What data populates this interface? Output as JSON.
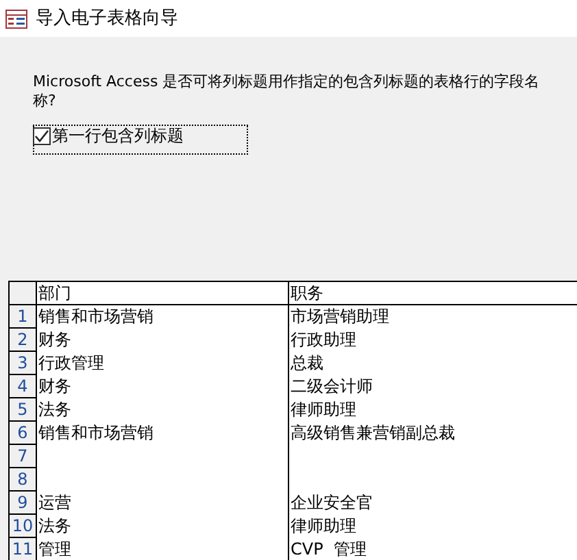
{
  "window": {
    "title": "导入电子表格向导"
  },
  "question": "Microsoft Access 是否可将列标题用作指定的包含列标题的表格行的字段名称?",
  "header_checkbox": {
    "label": "第一行包含列标题",
    "checked": true
  },
  "table": {
    "columns": [
      "部门",
      "职务"
    ],
    "rows": [
      {
        "number": "1",
        "cells": [
          "销售和市场营销",
          "市场营销助理"
        ]
      },
      {
        "number": "2",
        "cells": [
          "财务",
          "行政助理"
        ]
      },
      {
        "number": "3",
        "cells": [
          "行政管理",
          "总裁"
        ]
      },
      {
        "number": "4",
        "cells": [
          "财务",
          "二级会计师"
        ]
      },
      {
        "number": "5",
        "cells": [
          "法务",
          "律师助理"
        ]
      },
      {
        "number": "6",
        "cells": [
          "销售和市场营销",
          "高级销售兼营销副总裁"
        ]
      },
      {
        "number": "7"
      },
      {
        "number": "8"
      },
      {
        "number": "9",
        "cells": [
          "运营",
          "企业安全官"
        ]
      },
      {
        "number": "10",
        "cells": [
          "法务",
          "律师助理"
        ]
      },
      {
        "number": "11",
        "cells": [
          "管理",
          "CVP  管理"
        ]
      }
    ]
  }
}
